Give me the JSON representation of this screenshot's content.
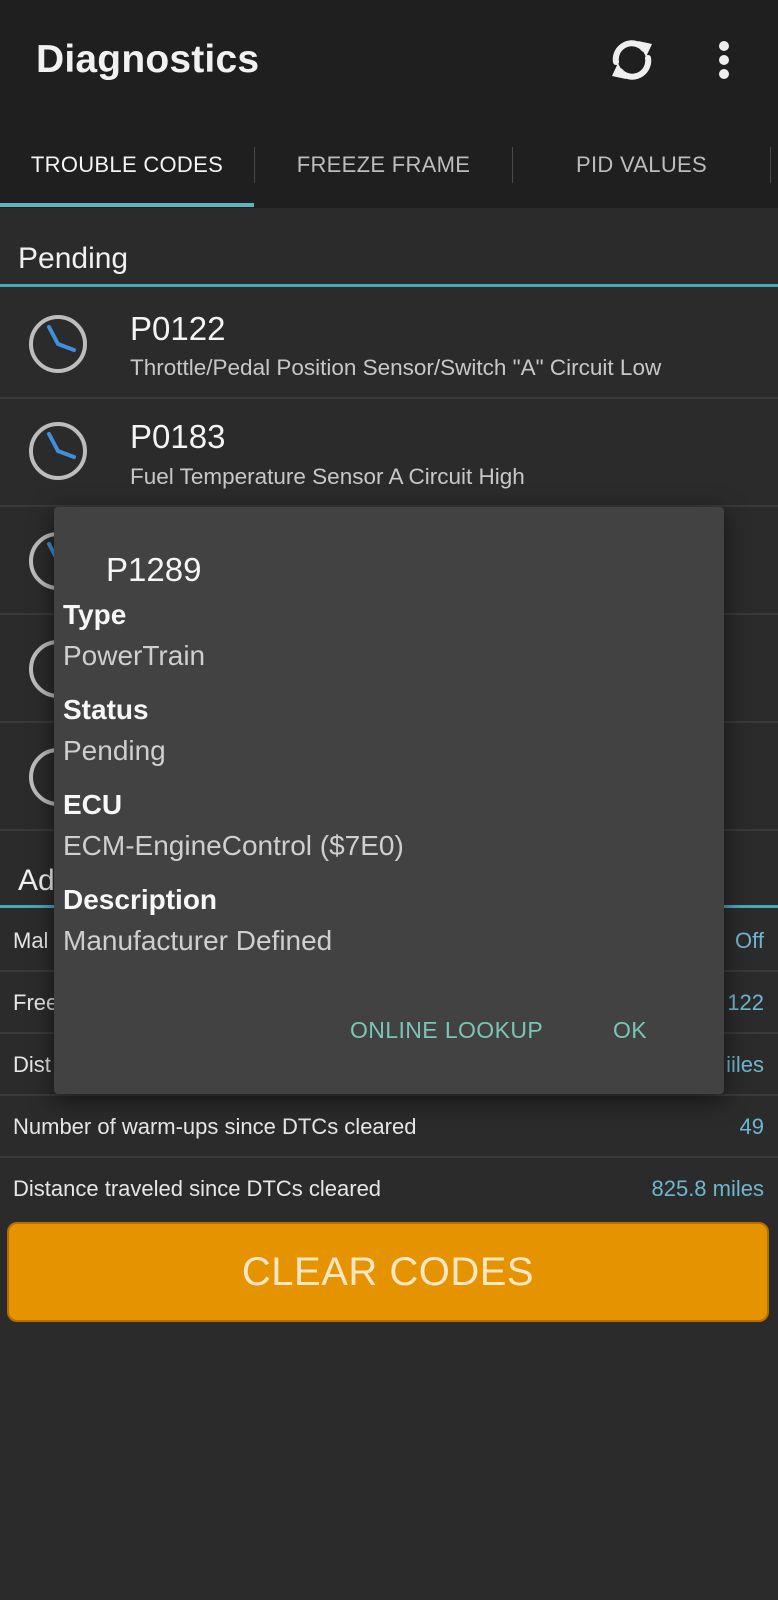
{
  "app": {
    "title": "Diagnostics"
  },
  "toolbar": {
    "refresh_icon": "refresh-icon",
    "menu_icon": "more-vert-icon"
  },
  "tabs": [
    {
      "label": "TROUBLE CODES",
      "active": true
    },
    {
      "label": "FREEZE FRAME",
      "active": false
    },
    {
      "label": "PID VALUES",
      "active": false
    }
  ],
  "pending": {
    "title": "Pending",
    "codes": [
      {
        "code": "P0122",
        "description": "Throttle/Pedal Position Sensor/Switch \"A\" Circuit Low"
      },
      {
        "code": "P0183",
        "description": "Fuel Temperature Sensor A Circuit High"
      }
    ]
  },
  "additional": {
    "title_partial": "Ad",
    "rows": [
      {
        "label": "Mal",
        "value": "Off"
      },
      {
        "label": "Free",
        "value": "122"
      },
      {
        "label": "Dist",
        "value": "iiles"
      },
      {
        "label": "Number of warm-ups since DTCs cleared",
        "value": "49"
      },
      {
        "label": "Distance traveled since DTCs cleared",
        "value": "825.8 miles"
      }
    ]
  },
  "clear_button": {
    "label": "CLEAR CODES"
  },
  "dialog": {
    "title": "P1289",
    "fields": [
      {
        "label": "Type",
        "value": "PowerTrain"
      },
      {
        "label": "Status",
        "value": "Pending"
      },
      {
        "label": "ECU",
        "value": "ECM-EngineControl ($7E0)"
      },
      {
        "label": "Description",
        "value": "Manufacturer Defined"
      }
    ],
    "buttons": {
      "lookup": "ONLINE LOOKUP",
      "ok": "OK"
    }
  },
  "colors": {
    "accent": "#5fb2c2",
    "button": "#e69300",
    "value": "#6fb6cf",
    "dialog_button": "#7cc5b6"
  }
}
